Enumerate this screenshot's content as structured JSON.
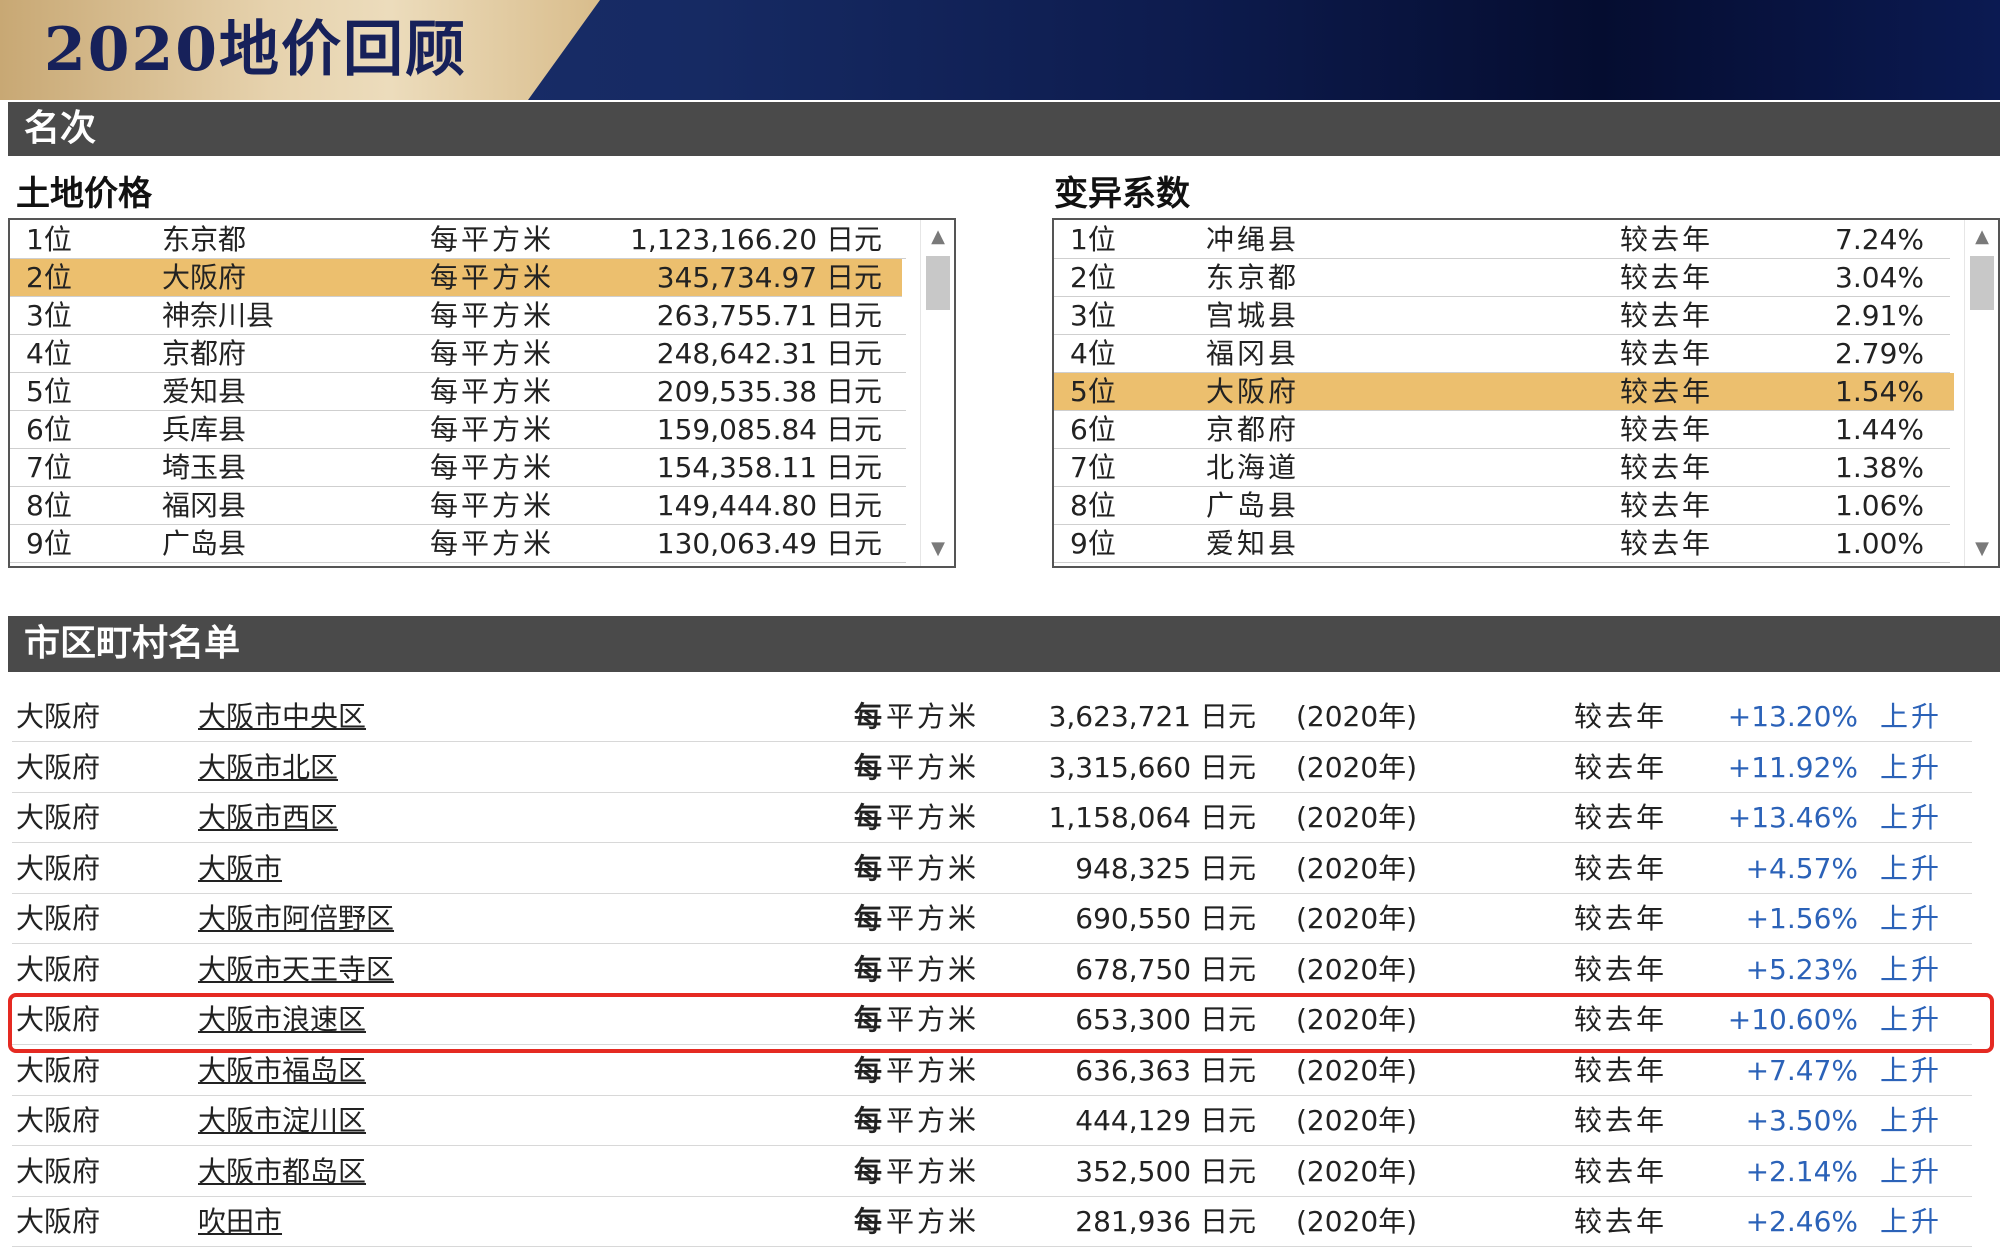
{
  "banner": {
    "title": "2020地价回顾"
  },
  "sections": {
    "ranking": "名次",
    "municipalities": "市区町村名单"
  },
  "land_price": {
    "title": "土地价格",
    "highlight_index": 1,
    "rows": [
      {
        "rank": "1位",
        "pref": "东京都",
        "unit": "每平方米",
        "value": "1,123,166.20 日元"
      },
      {
        "rank": "2位",
        "pref": "大阪府",
        "unit": "每平方米",
        "value": "345,734.97 日元"
      },
      {
        "rank": "3位",
        "pref": "神奈川县",
        "unit": "每平方米",
        "value": "263,755.71 日元"
      },
      {
        "rank": "4位",
        "pref": "京都府",
        "unit": "每平方米",
        "value": "248,642.31 日元"
      },
      {
        "rank": "5位",
        "pref": "爱知县",
        "unit": "每平方米",
        "value": "209,535.38 日元"
      },
      {
        "rank": "6位",
        "pref": "兵库县",
        "unit": "每平方米",
        "value": "159,085.84 日元"
      },
      {
        "rank": "7位",
        "pref": "埼玉县",
        "unit": "每平方米",
        "value": "154,358.11 日元"
      },
      {
        "rank": "8位",
        "pref": "福冈县",
        "unit": "每平方米",
        "value": "149,444.80 日元"
      },
      {
        "rank": "9位",
        "pref": "广岛县",
        "unit": "每平方米",
        "value": "130,063.49 日元"
      }
    ]
  },
  "variation": {
    "title": "变异系数",
    "highlight_index": 4,
    "rows": [
      {
        "rank": "1位",
        "pref": "冲绳县",
        "label": "较去年",
        "value": "7.24%"
      },
      {
        "rank": "2位",
        "pref": "东京都",
        "label": "较去年",
        "value": "3.04%"
      },
      {
        "rank": "3位",
        "pref": "宫城县",
        "label": "较去年",
        "value": "2.91%"
      },
      {
        "rank": "4位",
        "pref": "福冈县",
        "label": "较去年",
        "value": "2.79%"
      },
      {
        "rank": "5位",
        "pref": "大阪府",
        "label": "较去年",
        "value": "1.54%"
      },
      {
        "rank": "6位",
        "pref": "京都府",
        "label": "较去年",
        "value": "1.44%"
      },
      {
        "rank": "7位",
        "pref": "北海道",
        "label": "较去年",
        "value": "1.38%"
      },
      {
        "rank": "8位",
        "pref": "广岛县",
        "label": "较去年",
        "value": "1.06%"
      },
      {
        "rank": "9位",
        "pref": "爱知县",
        "label": "较去年",
        "value": "1.00%"
      }
    ]
  },
  "scroll": {
    "up": "▲",
    "down": "▼"
  },
  "municipalities": {
    "highlight_index": 6,
    "rows": [
      {
        "pref": "大阪府",
        "city": "大阪市中央区",
        "unit_bold": "每",
        "unit_rest": "平方米",
        "price": "3,623,721 日元",
        "year": "(2020年)",
        "label": "较去年",
        "change": "+13.20%",
        "trend": "上升"
      },
      {
        "pref": "大阪府",
        "city": "大阪市北区",
        "unit_bold": "每",
        "unit_rest": "平方米",
        "price": "3,315,660 日元",
        "year": "(2020年)",
        "label": "较去年",
        "change": "+11.92%",
        "trend": "上升"
      },
      {
        "pref": "大阪府",
        "city": "大阪市西区",
        "unit_bold": "每",
        "unit_rest": "平方米",
        "price": "1,158,064 日元",
        "year": "(2020年)",
        "label": "较去年",
        "change": "+13.46%",
        "trend": "上升"
      },
      {
        "pref": "大阪府",
        "city": "大阪市",
        "unit_bold": "每",
        "unit_rest": "平方米",
        "price": "948,325 日元",
        "year": "(2020年)",
        "label": "较去年",
        "change": "+4.57%",
        "trend": "上升"
      },
      {
        "pref": "大阪府",
        "city": "大阪市阿倍野区",
        "unit_bold": "每",
        "unit_rest": "平方米",
        "price": "690,550 日元",
        "year": "(2020年)",
        "label": "较去年",
        "change": "+1.56%",
        "trend": "上升"
      },
      {
        "pref": "大阪府",
        "city": "大阪市天王寺区",
        "unit_bold": "每",
        "unit_rest": "平方米",
        "price": "678,750 日元",
        "year": "(2020年)",
        "label": "较去年",
        "change": "+5.23%",
        "trend": "上升"
      },
      {
        "pref": "大阪府",
        "city": "大阪市浪速区",
        "unit_bold": "每",
        "unit_rest": "平方米",
        "price": "653,300 日元",
        "year": "(2020年)",
        "label": "较去年",
        "change": "+10.60%",
        "trend": "上升"
      },
      {
        "pref": "大阪府",
        "city": "大阪市福岛区",
        "unit_bold": "每",
        "unit_rest": "平方米",
        "price": "636,363 日元",
        "year": "(2020年)",
        "label": "较去年",
        "change": "+7.47%",
        "trend": "上升"
      },
      {
        "pref": "大阪府",
        "city": "大阪市淀川区",
        "unit_bold": "每",
        "unit_rest": "平方米",
        "price": "444,129 日元",
        "year": "(2020年)",
        "label": "较去年",
        "change": "+3.50%",
        "trend": "上升"
      },
      {
        "pref": "大阪府",
        "city": "大阪市都岛区",
        "unit_bold": "每",
        "unit_rest": "平方米",
        "price": "352,500 日元",
        "year": "(2020年)",
        "label": "较去年",
        "change": "+2.14%",
        "trend": "上升"
      },
      {
        "pref": "大阪府",
        "city": "吹田市",
        "unit_bold": "每",
        "unit_rest": "平方米",
        "price": "281,936 日元",
        "year": "(2020年)",
        "label": "较去年",
        "change": "+2.46%",
        "trend": "上升"
      }
    ]
  },
  "colors": {
    "highlight_row": "#ecbf6e",
    "section_bar": "#4a4a4a",
    "change_text": "#2b62b8",
    "highlight_frame": "#e52a22",
    "banner_blue": "#0f1f57",
    "banner_gold": "#e6d2ad"
  }
}
